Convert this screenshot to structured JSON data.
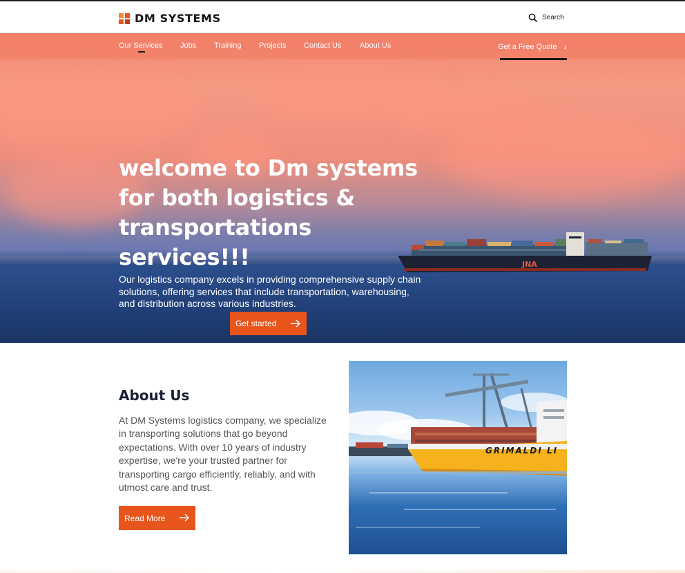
{
  "header": {
    "logo_text": "DM SYSTEMS",
    "search_label": "Search"
  },
  "nav": {
    "items": [
      {
        "label": "Our Services",
        "active": true
      },
      {
        "label": "Jobs"
      },
      {
        "label": "Training"
      },
      {
        "label": "Projects"
      },
      {
        "label": "Contact Us"
      },
      {
        "label": "About Us"
      }
    ],
    "quote_label": "Get a Free Quote"
  },
  "hero": {
    "title_lines": [
      "welcome to Dm systems",
      "for both logistics &",
      "transportations services!!!"
    ],
    "description": "Our logistics company excels in providing comprehensive supply chain solutions, offering services that include transportation, warehousing, and distribution across various industries.",
    "button_label": "Get started",
    "ship_logo": "JNA"
  },
  "about": {
    "title": "About Us",
    "text": "At DM Systems logistics company, we specialize in transporting solutions that go beyond expectations. With over 10 years of industry expertise, we're your trusted partner for  transporting cargo efficiently, reliably, and with utmost care and trust.",
    "button_label": "Read More",
    "photo_ship_text": "GRIMALDI LI"
  },
  "colors": {
    "accent": "#e8551c",
    "heading": "#1b1e35",
    "hero_sky": "#f48770",
    "hero_sea": "#213f77"
  },
  "icons": {
    "search": "search-icon",
    "quote_chevron": "chevron-right-icon",
    "button_arrow": "arrow-right-icon"
  }
}
